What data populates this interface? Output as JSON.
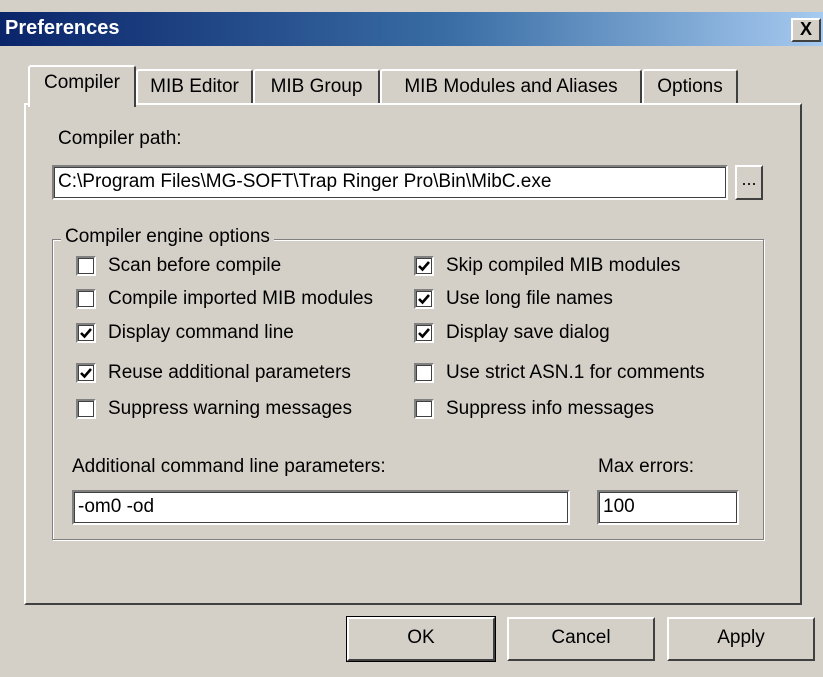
{
  "window": {
    "title": "Preferences",
    "close_label": "X"
  },
  "tabs": [
    {
      "label": "Compiler",
      "active": true
    },
    {
      "label": "MIB Editor",
      "active": false
    },
    {
      "label": "MIB Group",
      "active": false
    },
    {
      "label": "MIB Modules and Aliases",
      "active": false
    },
    {
      "label": "Options",
      "active": false
    }
  ],
  "compiler": {
    "path_label": "Compiler path:",
    "path_value": "C:\\Program Files\\MG-SOFT\\Trap Ringer Pro\\Bin\\MibC.exe",
    "browse_label": "..."
  },
  "engine_options": {
    "caption": "Compiler engine options",
    "left": [
      {
        "label": "Scan before compile",
        "checked": false
      },
      {
        "label": "Compile imported MIB modules",
        "checked": false
      },
      {
        "label": "Display command line",
        "checked": true
      },
      {
        "label": "Reuse additional parameters",
        "checked": true
      },
      {
        "label": "Suppress warning messages",
        "checked": false
      }
    ],
    "right": [
      {
        "label": "Skip compiled MIB modules",
        "checked": true
      },
      {
        "label": "Use long file names",
        "checked": true
      },
      {
        "label": "Display save dialog",
        "checked": true
      },
      {
        "label": "Use strict ASN.1 for comments",
        "checked": false
      },
      {
        "label": "Suppress info messages",
        "checked": false
      }
    ],
    "params_label": "Additional command line parameters:",
    "params_value": "-om0 -od",
    "max_errors_label": "Max errors:",
    "max_errors_value": "100"
  },
  "buttons": {
    "ok": "OK",
    "cancel": "Cancel",
    "apply": "Apply"
  }
}
